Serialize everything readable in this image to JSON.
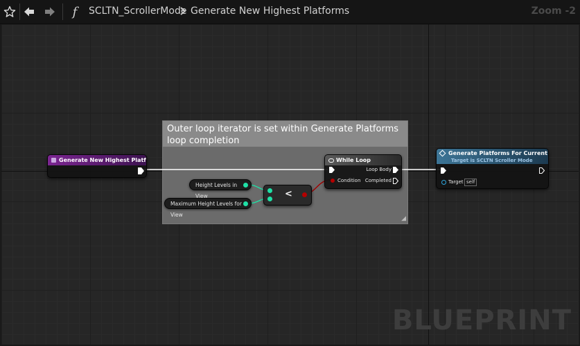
{
  "toolbar": {
    "icons": [
      "star-icon",
      "back-arrow-icon",
      "forward-arrow-icon",
      "function-icon",
      "chevron-right-icon"
    ],
    "function_glyph": "f",
    "breadcrumb_class": "SCLTN_ScrollerMode",
    "breadcrumb_function": "Generate New Highest Platforms",
    "zoom": "Zoom -2"
  },
  "graph": {
    "watermark": "BLUEPRINT",
    "comment": {
      "text": "Outer loop iterator is set within Generate Platforms loop completion"
    },
    "entry_node": {
      "title": "Generate New Highest Platforms",
      "header_color": "#6a1f78"
    },
    "var_height_levels": {
      "label": "Height Levels in View"
    },
    "var_max_height_levels": {
      "label": "Maximum Height Levels for View"
    },
    "compare_node": {
      "operator": "<"
    },
    "while_node": {
      "title": "While Loop",
      "condition_label": "Condition",
      "loop_body_label": "Loop Body",
      "completed_label": "Completed"
    },
    "call_node": {
      "title": "Generate Platforms For Current Height",
      "subtitle": "Target is SCLTN Scroller Mode",
      "target_label": "Target",
      "target_value": "self",
      "header_color": "#2e5d7a"
    },
    "colors": {
      "exec": "#ffffff",
      "int_pin": "#1fe0a6",
      "bool_pin": "#9a0000",
      "object_pin": "#2ea7e0"
    }
  }
}
